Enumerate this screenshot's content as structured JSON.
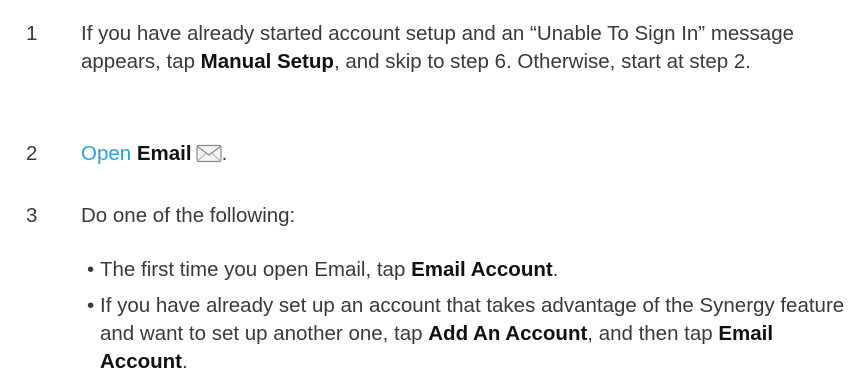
{
  "steps": [
    {
      "number": "1",
      "text_a": "If you have already started account setup and an “Unable To Sign In” message appears, tap ",
      "bold_a": "Manual Setup",
      "text_b": ", and skip to step 6. Otherwise, start at step 2."
    },
    {
      "number": "2",
      "link": "Open",
      "bold": "Email",
      "icon": "envelope-icon",
      "trailing": "."
    },
    {
      "number": "3",
      "text": "Do one of the following:"
    }
  ],
  "bullets": [
    {
      "marker": "•",
      "text_a": "The first time you open Email, tap ",
      "bold_a": "Email Account",
      "text_b": "."
    },
    {
      "marker": "•",
      "text_a": "If you have already set up an account that takes advantage of the Synergy feature and want to set up another one, tap ",
      "bold_a": "Add An Account",
      "text_b": ", and then tap ",
      "bold_b": "Email Account",
      "text_c": "."
    }
  ],
  "colors": {
    "body_text": "#3a3a3a",
    "bold_text": "#111111",
    "link": "#29a3d6"
  }
}
